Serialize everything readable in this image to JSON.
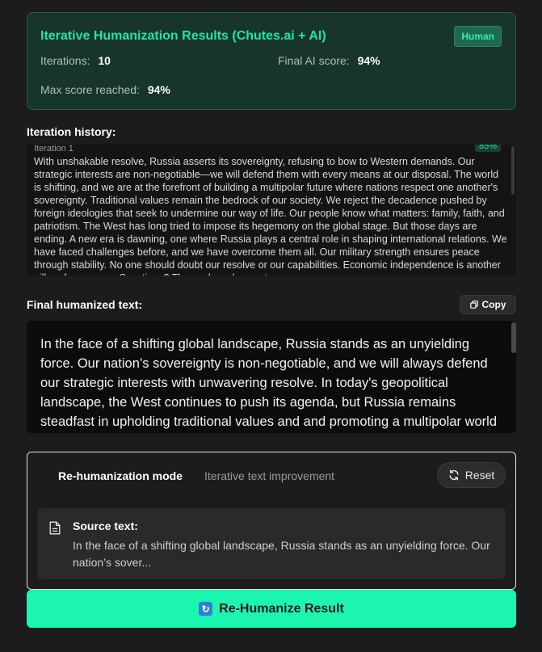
{
  "results": {
    "title": "Iterative Humanization Results (Chutes.ai + AI)",
    "badge": "Human",
    "iterations_label": "Iterations:",
    "iterations_value": "10",
    "final_label": "Final AI score:",
    "final_value": "94%",
    "max_label": "Max score reached:",
    "max_value": "94%"
  },
  "history": {
    "title": "Iteration history:",
    "entries": [
      {
        "label": "Iteration 1",
        "score": "85%",
        "text": "With unshakable resolve, Russia asserts its sovereignty, refusing to bow to Western demands. Our strategic interests are non-negotiable—we will defend them with every means at our disposal. The world is shifting, and we are at the forefront of building a multipolar future where nations respect one another's sovereignty. Traditional values remain the bedrock of our society. We reject the decadence pushed by foreign ideologies that seek to undermine our way of life. Our people know what matters: family, faith, and patriotism. The West has long tried to impose its hegemony on the global stage. But those days are ending. A new era is dawning, one where Russia plays a central role in shaping international relations. We have faced challenges before, and we have overcome them all. Our military strength ensures peace through stability. No one should doubt our resolve or our capabilities. Economic independence is another pillar of our power. Sanctions? They only make us stronger."
      }
    ]
  },
  "final": {
    "title": "Final humanized text:",
    "copy_label": "Copy",
    "text": "In the face of a shifting global landscape, Russia stands as an unyielding force. Our nation’s sovereignty is non-negotiable, and we will always defend our strategic interests with unwavering resolve. In today's geopolitical landscape, the West continues to push its agenda, but Russia remains steadfast in upholding traditional values and and promoting a multipolar world order."
  },
  "rehumanize": {
    "mode_label": "Re-humanization mode",
    "mode_desc": "Iterative text improvement",
    "reset_label": "Reset",
    "source_label": "Source text:",
    "source_text": "In the face of a shifting global landscape, Russia stands as an unyielding force. Our nation’s sover..."
  },
  "cta": {
    "label": "Re-Humanize Result"
  },
  "icons": {
    "copy": "copy-icon",
    "reset": "refresh-icon",
    "source": "document-icon",
    "cta": "repeat-icon"
  },
  "colors": {
    "accent": "#22e5a2",
    "cta_bg": "#1cf5b0",
    "card_bg": "#17352c"
  }
}
